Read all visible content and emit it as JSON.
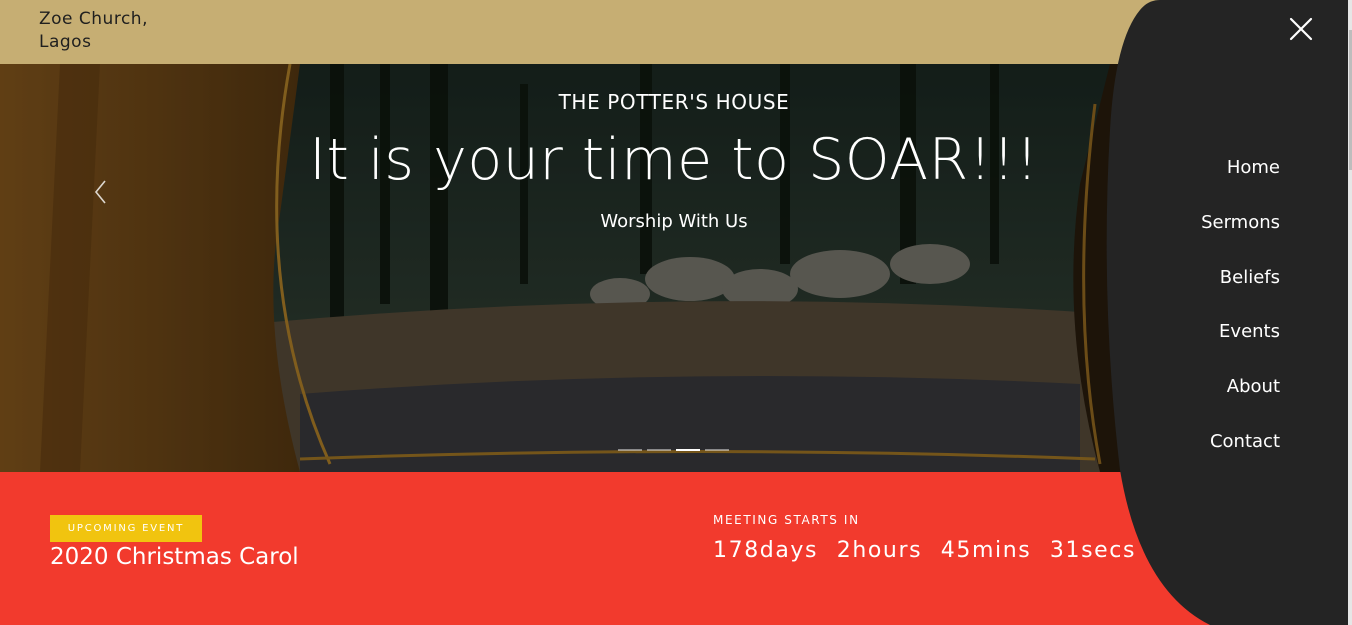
{
  "brand": {
    "line1": "Zoe Church,",
    "line2": "Lagos"
  },
  "hero": {
    "kicker": "THE POTTER'S HOUSE",
    "title": "It is your time to SOAR!!!",
    "subtitle": "Worship With Us",
    "slides_total": 4,
    "active_slide": 3
  },
  "event": {
    "badge": "UPCOMING EVENT",
    "title": "2020 Christmas Carol",
    "meeting_label": "MEETING STARTS IN",
    "countdown": {
      "days": "178days",
      "hours": "2hours",
      "mins": "45mins",
      "secs": "31secs"
    }
  },
  "menu": {
    "items": [
      "Home",
      "Sermons",
      "Beliefs",
      "Events",
      "About",
      "Contact"
    ]
  },
  "icons": {
    "close": "close-icon",
    "prev": "chevron-left-icon"
  },
  "colors": {
    "topbar": "#c6ae73",
    "event_band": "#f23a2d",
    "badge": "#f1c40f",
    "menu_panel": "#242424"
  }
}
